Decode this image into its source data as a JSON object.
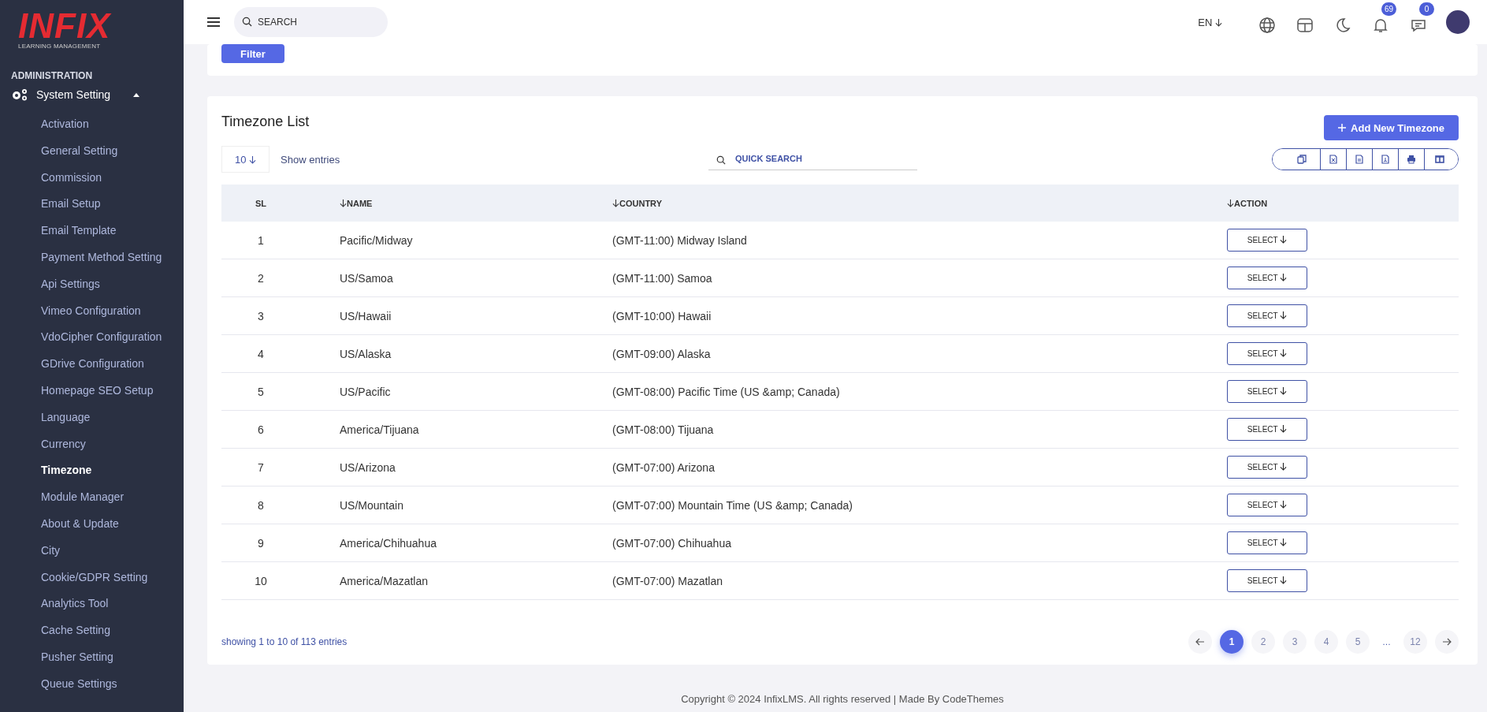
{
  "sidebar": {
    "logo": {
      "title": "INFIX",
      "subtitle": "LEARNING MANAGEMENT"
    },
    "section": "ADMINISTRATION",
    "group": {
      "label": "System Setting",
      "expanded": true
    },
    "items": [
      {
        "label": "Activation",
        "selected": false
      },
      {
        "label": "General Setting",
        "selected": false
      },
      {
        "label": "Commission",
        "selected": false
      },
      {
        "label": "Email Setup",
        "selected": false
      },
      {
        "label": "Email Template",
        "selected": false
      },
      {
        "label": "Payment Method Setting",
        "selected": false
      },
      {
        "label": "Api Settings",
        "selected": false
      },
      {
        "label": "Vimeo Configuration",
        "selected": false
      },
      {
        "label": "VdoCipher Configuration",
        "selected": false
      },
      {
        "label": "GDrive Configuration",
        "selected": false
      },
      {
        "label": "Homepage SEO Setup",
        "selected": false
      },
      {
        "label": "Language",
        "selected": false
      },
      {
        "label": "Currency",
        "selected": false
      },
      {
        "label": "Timezone",
        "selected": true
      },
      {
        "label": "Module Manager",
        "selected": false
      },
      {
        "label": "About & Update",
        "selected": false
      },
      {
        "label": "City",
        "selected": false
      },
      {
        "label": "Cookie/GDPR Setting",
        "selected": false
      },
      {
        "label": "Analytics Tool",
        "selected": false
      },
      {
        "label": "Cache Setting",
        "selected": false
      },
      {
        "label": "Pusher Setting",
        "selected": false
      },
      {
        "label": "Queue Settings",
        "selected": false
      }
    ]
  },
  "topbar": {
    "search": {
      "placeholder": "SEARCH"
    },
    "language": "EN",
    "icons": [
      {
        "kind": "globe"
      },
      {
        "kind": "layout"
      },
      {
        "kind": "moon"
      },
      {
        "kind": "bell",
        "badge": "69"
      },
      {
        "kind": "chat",
        "badge": "0"
      },
      {
        "kind": "avatar"
      }
    ]
  },
  "filter_button": "Filter",
  "timezone_list": {
    "title": "Timezone List",
    "add_button": "Add New Timezone",
    "page_size": "10",
    "show_entries": "Show entries",
    "quick_search": {
      "placeholder": "QUICK SEARCH"
    },
    "export_buttons": [
      {
        "kind": "copy"
      },
      {
        "kind": "excel"
      },
      {
        "kind": "csv"
      },
      {
        "kind": "pdf"
      },
      {
        "kind": "print"
      },
      {
        "kind": "columns"
      }
    ],
    "columns": [
      {
        "label": "SL",
        "sortable": false
      },
      {
        "label": "NAME",
        "sortable": true
      },
      {
        "label": "COUNTRY",
        "sortable": true
      },
      {
        "label": "ACTION",
        "sortable": true
      }
    ],
    "rows": [
      {
        "sl": "1",
        "name": "Pacific/Midway",
        "country": "(GMT-11:00) Midway Island",
        "action": "SELECT"
      },
      {
        "sl": "2",
        "name": "US/Samoa",
        "country": "(GMT-11:00) Samoa",
        "action": "SELECT"
      },
      {
        "sl": "3",
        "name": "US/Hawaii",
        "country": "(GMT-10:00) Hawaii",
        "action": "SELECT"
      },
      {
        "sl": "4",
        "name": "US/Alaska",
        "country": "(GMT-09:00) Alaska",
        "action": "SELECT"
      },
      {
        "sl": "5",
        "name": "US/Pacific",
        "country": "(GMT-08:00) Pacific Time (US &amp; Canada)",
        "action": "SELECT"
      },
      {
        "sl": "6",
        "name": "America/Tijuana",
        "country": "(GMT-08:00) Tijuana",
        "action": "SELECT"
      },
      {
        "sl": "7",
        "name": "US/Arizona",
        "country": "(GMT-07:00) Arizona",
        "action": "SELECT"
      },
      {
        "sl": "8",
        "name": "US/Mountain",
        "country": "(GMT-07:00) Mountain Time (US &amp; Canada)",
        "action": "SELECT"
      },
      {
        "sl": "9",
        "name": "America/Chihuahua",
        "country": "(GMT-07:00) Chihuahua",
        "action": "SELECT"
      },
      {
        "sl": "10",
        "name": "America/Mazatlan",
        "country": "(GMT-07:00) Mazatlan",
        "action": "SELECT"
      }
    ],
    "summary": "showing 1 to 10 of 113 entries",
    "pagination": [
      {
        "label": "1",
        "selected": true
      },
      {
        "label": "2",
        "selected": false
      },
      {
        "label": "3",
        "selected": false
      },
      {
        "label": "4",
        "selected": false
      },
      {
        "label": "5",
        "selected": false
      },
      {
        "label": "…",
        "kind": "gap"
      },
      {
        "label": "12",
        "selected": false
      }
    ]
  },
  "footer": "Copyright © 2024 InfixLMS. All rights reserved | Made By CodeThemes"
}
